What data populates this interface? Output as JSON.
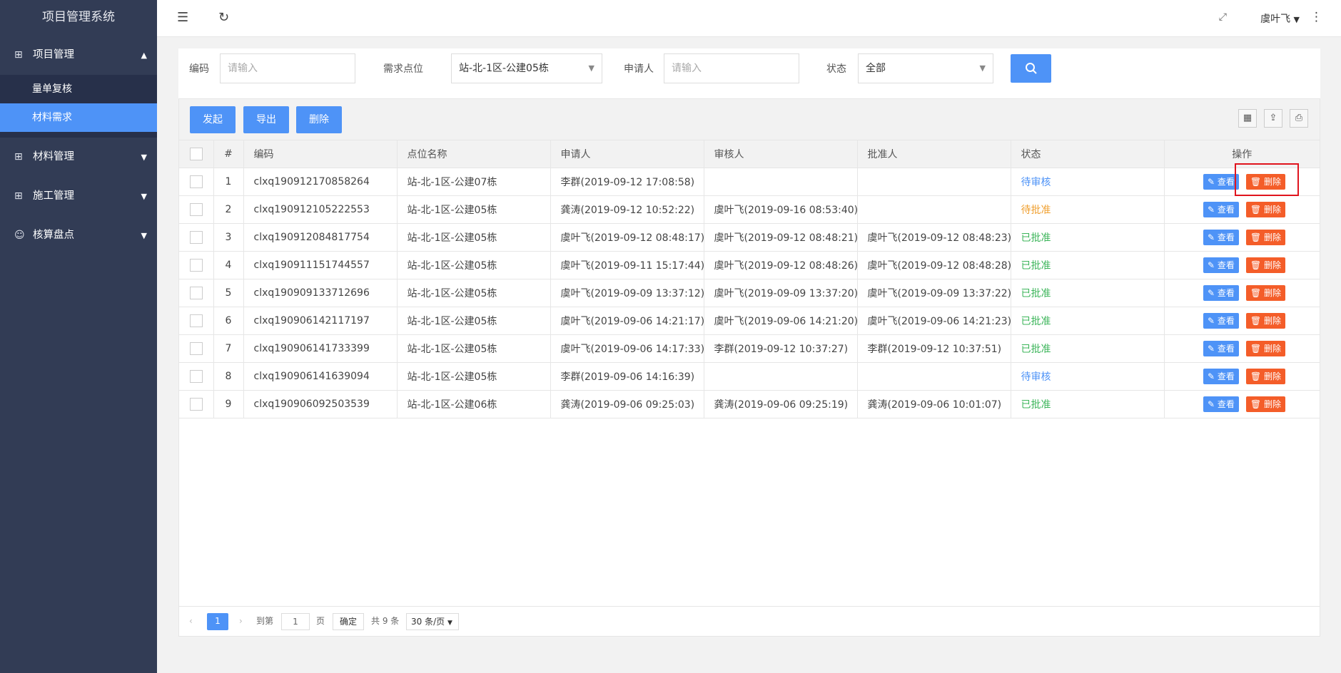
{
  "app": {
    "title": "项目管理系统"
  },
  "sidebar": {
    "groups": [
      {
        "label": "项目管理",
        "icon": "grid-plus-icon",
        "expanded": true,
        "items": [
          {
            "label": "量单复核",
            "active": false
          },
          {
            "label": "材料需求",
            "active": true
          }
        ]
      },
      {
        "label": "材料管理",
        "icon": "grid-plus-icon",
        "expanded": false
      },
      {
        "label": "施工管理",
        "icon": "grid-plus-icon",
        "expanded": false
      },
      {
        "label": "核算盘点",
        "icon": "user-icon",
        "expanded": false
      }
    ]
  },
  "header": {
    "user": "虞叶飞"
  },
  "filters": {
    "code_label": "编码",
    "code_placeholder": "请输入",
    "point_label": "需求点位",
    "point_value": "站-北-1区-公建05栋",
    "applicant_label": "申请人",
    "applicant_placeholder": "请输入",
    "status_label": "状态",
    "status_value": "全部"
  },
  "toolbar": {
    "create": "发起",
    "export": "导出",
    "delete": "删除"
  },
  "table": {
    "headers": [
      "#",
      "编码",
      "点位名称",
      "申请人",
      "审核人",
      "批准人",
      "状态",
      "操作"
    ],
    "view_label": "查看",
    "delete_label": "删除",
    "rows": [
      {
        "num": "1",
        "code": "clxq190912170858264",
        "point": "站-北-1区-公建07栋",
        "applicant": "李群(2019-09-12 17:08:58)",
        "reviewer": "",
        "approver": "",
        "status": "待审核",
        "status_color": "#4e93f7"
      },
      {
        "num": "2",
        "code": "clxq190912105222553",
        "point": "站-北-1区-公建05栋",
        "applicant": "龚涛(2019-09-12 10:52:22)",
        "reviewer": "虞叶飞(2019-09-16 08:53:40)",
        "approver": "",
        "status": "待批准",
        "status_color": "#f0a030"
      },
      {
        "num": "3",
        "code": "clxq190912084817754",
        "point": "站-北-1区-公建05栋",
        "applicant": "虞叶飞(2019-09-12 08:48:17)",
        "reviewer": "虞叶飞(2019-09-12 08:48:21)",
        "approver": "虞叶飞(2019-09-12 08:48:23)",
        "status": "已批准",
        "status_color": "#3cb55a"
      },
      {
        "num": "4",
        "code": "clxq190911151744557",
        "point": "站-北-1区-公建05栋",
        "applicant": "虞叶飞(2019-09-11 15:17:44)",
        "reviewer": "虞叶飞(2019-09-12 08:48:26)",
        "approver": "虞叶飞(2019-09-12 08:48:28)",
        "status": "已批准",
        "status_color": "#3cb55a"
      },
      {
        "num": "5",
        "code": "clxq190909133712696",
        "point": "站-北-1区-公建05栋",
        "applicant": "虞叶飞(2019-09-09 13:37:12)",
        "reviewer": "虞叶飞(2019-09-09 13:37:20)",
        "approver": "虞叶飞(2019-09-09 13:37:22)",
        "status": "已批准",
        "status_color": "#3cb55a"
      },
      {
        "num": "6",
        "code": "clxq190906142117197",
        "point": "站-北-1区-公建05栋",
        "applicant": "虞叶飞(2019-09-06 14:21:17)",
        "reviewer": "虞叶飞(2019-09-06 14:21:20)",
        "approver": "虞叶飞(2019-09-06 14:21:23)",
        "status": "已批准",
        "status_color": "#3cb55a"
      },
      {
        "num": "7",
        "code": "clxq190906141733399",
        "point": "站-北-1区-公建05栋",
        "applicant": "虞叶飞(2019-09-06 14:17:33)",
        "reviewer": "李群(2019-09-12 10:37:27)",
        "approver": "李群(2019-09-12 10:37:51)",
        "status": "已批准",
        "status_color": "#3cb55a"
      },
      {
        "num": "8",
        "code": "clxq190906141639094",
        "point": "站-北-1区-公建05栋",
        "applicant": "李群(2019-09-06 14:16:39)",
        "reviewer": "",
        "approver": "",
        "status": "待审核",
        "status_color": "#4e93f7"
      },
      {
        "num": "9",
        "code": "clxq190906092503539",
        "point": "站-北-1区-公建06栋",
        "applicant": "龚涛(2019-09-06 09:25:03)",
        "reviewer": "龚涛(2019-09-06 09:25:19)",
        "approver": "龚涛(2019-09-06 10:01:07)",
        "status": "已批准",
        "status_color": "#3cb55a"
      }
    ]
  },
  "pagination": {
    "current_page": "1",
    "goto_label": "到第",
    "goto_value": "1",
    "page_unit": "页",
    "confirm": "确定",
    "total": "共 9 条",
    "page_size": "30 条/页"
  }
}
